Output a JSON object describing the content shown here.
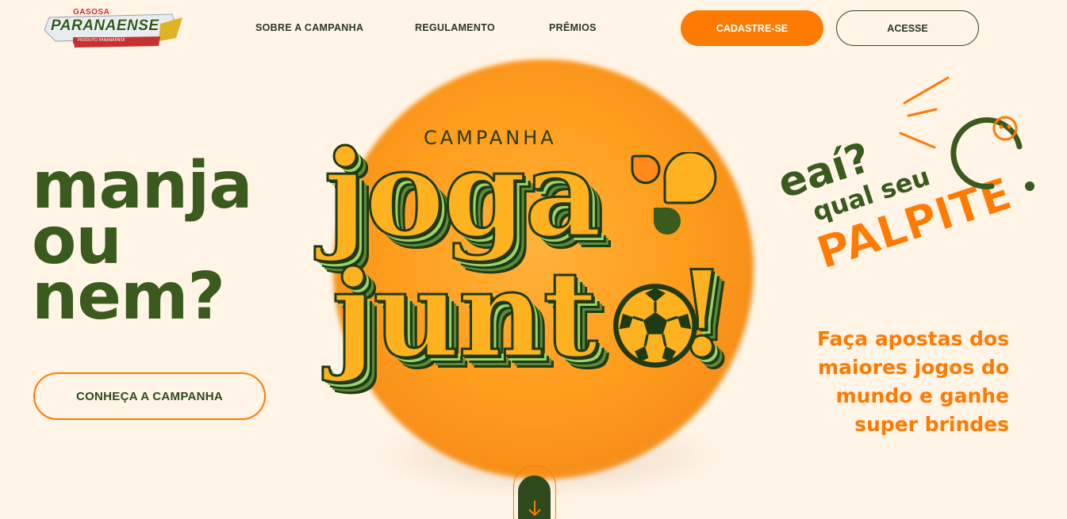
{
  "brand": {
    "top": "GASOSA",
    "name": "PARANAENSE",
    "sub": "PRODUTO PARANAENSE"
  },
  "nav": {
    "items": [
      {
        "label": "SOBRE A CAMPANHA"
      },
      {
        "label": "REGULAMENTO"
      },
      {
        "label": "PRÊMIOS"
      }
    ],
    "cadastre_label": "CADASTRE-SE",
    "acesse_label": "ACESSE"
  },
  "hero": {
    "headline": [
      "manja",
      "ou",
      "nem?"
    ],
    "cta_label": "CONHEÇA A CAMPANHA",
    "campaign_label": "CAMPANHA",
    "logo_word_1": "joga",
    "logo_word_2": "junt",
    "logo_word_end": "!",
    "palpite": {
      "line1": "eaí?",
      "line2": "qual seu",
      "line3": "PALPITE"
    },
    "tagline": [
      "Faça apostas dos",
      "maiores jogos do",
      "mundo e ganhe",
      "super brindes"
    ]
  },
  "colors": {
    "background": "#fff4e6",
    "accent_orange": "#ff7a00",
    "brand_green": "#3a5a1e",
    "logo_yellow": "#ffb21f"
  },
  "icons": {
    "scroll": "arrow-down-icon",
    "ball": "soccer-ball-icon"
  }
}
